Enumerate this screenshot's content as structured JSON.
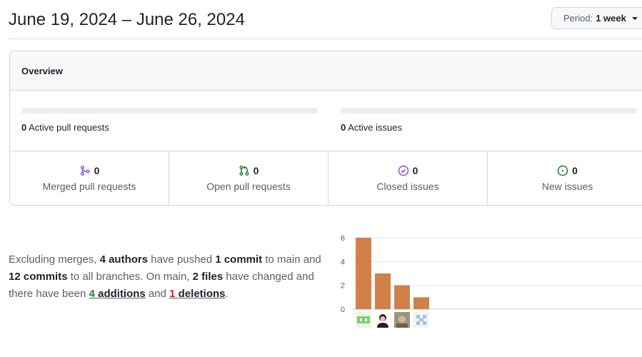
{
  "header": {
    "date_range": "June 19, 2024 – June 26, 2024",
    "period_label": "Period:",
    "period_value": "1 week",
    "period_icon": "caret-down-icon"
  },
  "overview": {
    "title": "Overview",
    "active_pull_requests": {
      "count": "0",
      "label": "Active pull requests",
      "progress": 0
    },
    "active_issues": {
      "count": "0",
      "label": "Active issues",
      "progress": 0
    },
    "stats": [
      {
        "icon": "git-merge-icon",
        "value": "0",
        "label": "Merged pull requests",
        "color": "#8250df"
      },
      {
        "icon": "git-pull-request-icon",
        "value": "0",
        "label": "Open pull requests",
        "color": "#1a7f37"
      },
      {
        "icon": "issue-closed-icon",
        "value": "0",
        "label": "Closed issues",
        "color": "#8250df"
      },
      {
        "icon": "issue-opened-icon",
        "value": "0",
        "label": "New issues",
        "color": "#1a7f37"
      }
    ]
  },
  "summary": {
    "p1": "Excluding merges, ",
    "authors": "4 authors",
    "p2": " have pushed ",
    "commit_main": "1 commit",
    "p3": " to main and ",
    "commits_all": "12 commits",
    "p4": " to all branches. On main, ",
    "files": "2 files",
    "p5": " have changed and there have been ",
    "additions_num": "4",
    "additions_word": " additions",
    "p6": " and ",
    "deletions_num": "1",
    "deletions_word": " deletions",
    "p7": "."
  },
  "chart_data": {
    "type": "bar",
    "categories": [
      "author-1",
      "author-2",
      "author-3",
      "author-4"
    ],
    "values": [
      6,
      3,
      2,
      1
    ],
    "ylim": [
      0,
      6
    ],
    "yticks": [
      0,
      2,
      4,
      6
    ],
    "grid": true,
    "bar_color": "#d1804a",
    "xlabel": "",
    "ylabel": "",
    "title": ""
  }
}
